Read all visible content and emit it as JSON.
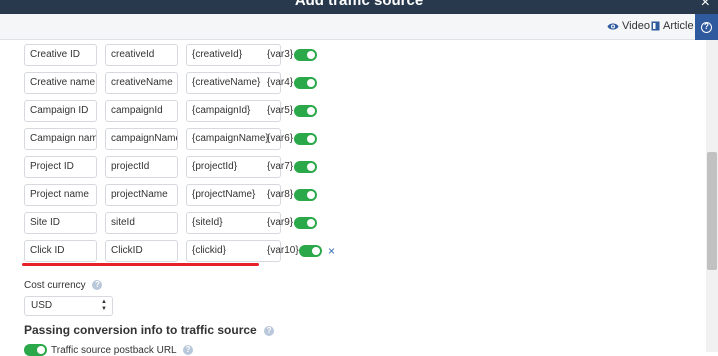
{
  "dialog": {
    "title": "Add traffic source",
    "close_glyph": "×"
  },
  "toolbar": {
    "video_label": "Video",
    "article_label": "Article",
    "help_glyph": "?"
  },
  "params": [
    {
      "name": "Creative ID",
      "param": "creativeId",
      "token": "{creativeId}",
      "var": "{var3}",
      "enabled": true
    },
    {
      "name": "Creative name",
      "param": "creativeName",
      "token": "{creativeName}",
      "var": "{var4}",
      "enabled": true
    },
    {
      "name": "Campaign ID",
      "param": "campaignId",
      "token": "{campaignId}",
      "var": "{var5}",
      "enabled": true
    },
    {
      "name": "Campaign name",
      "param": "campaignName",
      "token": "{campaignName}",
      "var": "{var6}",
      "enabled": true
    },
    {
      "name": "Project ID",
      "param": "projectId",
      "token": "{projectId}",
      "var": "{var7}",
      "enabled": true
    },
    {
      "name": "Project name",
      "param": "projectName",
      "token": "{projectName}",
      "var": "{var8}",
      "enabled": true
    },
    {
      "name": "Site ID",
      "param": "siteId",
      "token": "{siteId}",
      "var": "{var9}",
      "enabled": true
    },
    {
      "name": "Click ID",
      "param": "ClickID",
      "token": "{clickid}",
      "var": "{var10}",
      "enabled": true,
      "delete_glyph": "×"
    }
  ],
  "cost_currency": {
    "label": "Cost currency",
    "value": "USD"
  },
  "conversion_section": {
    "title": "Passing conversion info to traffic source",
    "postback_label": "Traffic source postback URL",
    "postback_enabled": true
  },
  "colors": {
    "toggle_on": "#2aa84a",
    "header_bg": "#29394d",
    "highlight_underline": "#e8202a",
    "accent": "#2f6bb3"
  }
}
